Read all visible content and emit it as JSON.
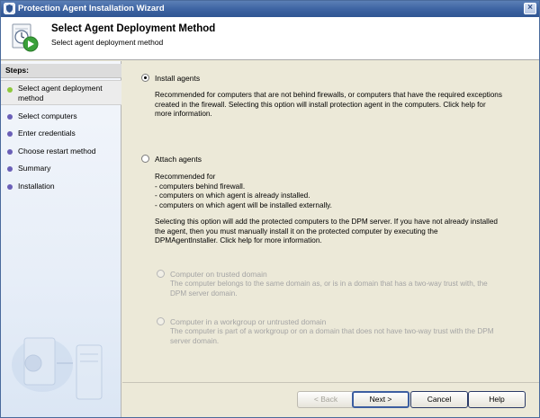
{
  "window": {
    "title": "Protection Agent Installation Wizard",
    "close_glyph": "×"
  },
  "header": {
    "title": "Select Agent Deployment Method",
    "subtitle": "Select agent deployment method",
    "icon": "wizard-clock-arrow-icon"
  },
  "sidebar": {
    "heading": "Steps:",
    "steps": [
      {
        "label_line1": "Select agent deployment",
        "label_line2": "method",
        "active": true
      },
      {
        "label": "Select computers"
      },
      {
        "label": "Enter credentials"
      },
      {
        "label": "Choose restart method"
      },
      {
        "label": "Summary"
      },
      {
        "label": "Installation"
      }
    ]
  },
  "options": {
    "install": {
      "label": "Install agents",
      "checked": true,
      "description": [
        "Recommended for computers that are not behind firewalls, or computers that have the required exceptions",
        "created in the firewall. Selecting this option will install protection agent in the computers. Click help for",
        "more information."
      ]
    },
    "attach": {
      "label": "Attach agents",
      "checked": false,
      "description": [
        "Recommended for",
        "- computers behind firewall.",
        "- computers on which agent is already installed.",
        "- computers on which agent will be installed externally."
      ],
      "description2": [
        "Selecting this option will add the protected computers to the DPM server. If you have not already installed",
        "the agent, then you must manually install it on the protected computer by executing the",
        "DPMAgentInstaller. Click help for more information."
      ],
      "sub_options": [
        {
          "label": "Computer on trusted domain",
          "description": [
            "The computer belongs to the same domain as, or is in a domain that has a two-way trust with, the",
            "DPM server domain."
          ]
        },
        {
          "label": "Computer in a workgroup or untrusted domain",
          "description": [
            "The computer is part of a workgroup or on a domain that does not have two-way trust with the DPM",
            "server domain."
          ]
        }
      ]
    }
  },
  "buttons": {
    "back": "< Back",
    "next": "Next >",
    "cancel": "Cancel",
    "help": "Help"
  }
}
